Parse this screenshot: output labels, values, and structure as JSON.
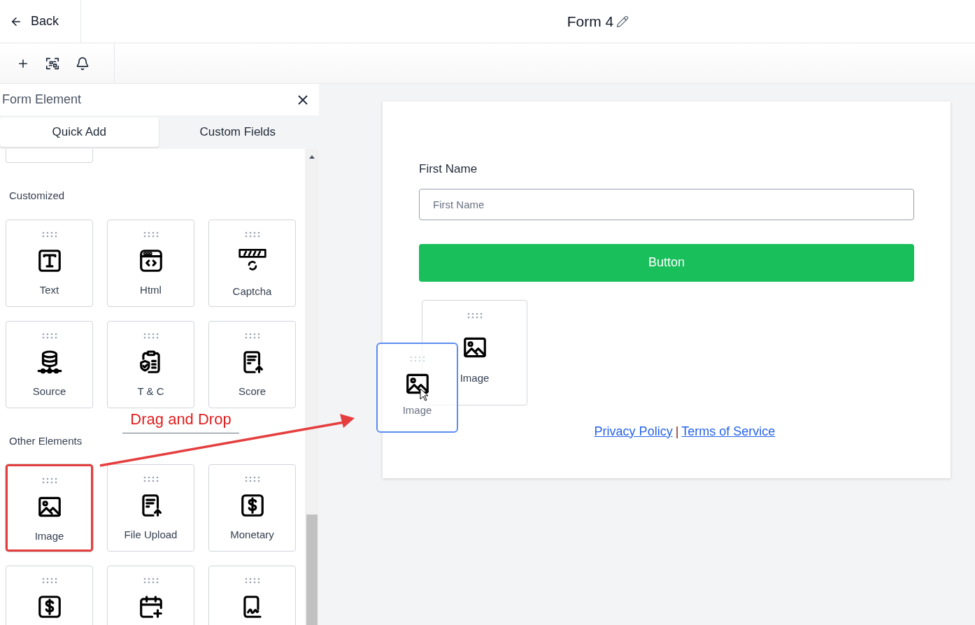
{
  "header": {
    "back": "Back",
    "title": "Form 4"
  },
  "panel": {
    "title": "Form Element",
    "tabs": [
      {
        "label": "Quick Add",
        "selected": true
      },
      {
        "label": "Custom Fields",
        "selected": false
      }
    ],
    "sections": [
      {
        "title": "Customized",
        "tiles": [
          {
            "kind": "text",
            "label": "Text",
            "highlighted": false
          },
          {
            "kind": "html",
            "label": "Html",
            "highlighted": false
          },
          {
            "kind": "captcha",
            "label": "Captcha",
            "highlighted": false
          },
          {
            "kind": "source",
            "label": "Source",
            "highlighted": false
          },
          {
            "kind": "terms",
            "label": "T & C",
            "highlighted": false
          },
          {
            "kind": "score",
            "label": "Score",
            "highlighted": false
          }
        ]
      },
      {
        "title": "Other Elements",
        "tiles": [
          {
            "kind": "image",
            "label": "Image",
            "highlighted": true
          },
          {
            "kind": "upload",
            "label": "File Upload",
            "highlighted": false
          },
          {
            "kind": "money",
            "label": "Monetary",
            "highlighted": false
          },
          {
            "kind": "money"
          },
          {
            "kind": "date"
          },
          {
            "kind": "signature"
          }
        ]
      }
    ]
  },
  "annotation": {
    "label": "Drag and Drop"
  },
  "form": {
    "field_label": "First Name",
    "field_placeholder": "First Name",
    "button": "Button",
    "dropped_tile": "Image",
    "dragging_tile": "Image",
    "links": [
      "Privacy Policy",
      "Terms of Service"
    ],
    "separator": "|"
  }
}
